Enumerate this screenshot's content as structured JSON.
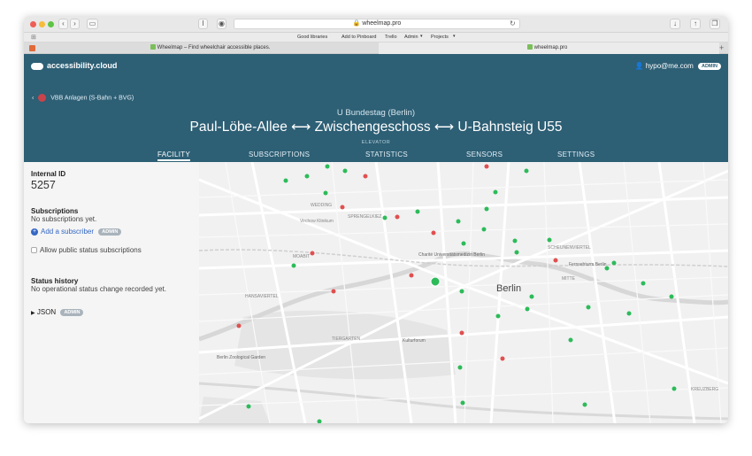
{
  "browser": {
    "url": "wheelmap.pro",
    "favorites": [
      "Good libraries",
      "Add to Pinboard",
      "Trello",
      "Admin",
      "Projects"
    ],
    "tabs": [
      {
        "label": "Wheelmap – Find wheelchair accessible places."
      },
      {
        "label": "wheelmap.pro"
      }
    ]
  },
  "app": {
    "brand": "accessibility.cloud",
    "user_email": "hypo@me.com",
    "user_badge": "ADMIN"
  },
  "breadcrumb": {
    "label": "VBB Anlagen (S-Bahn + BVG)"
  },
  "facility": {
    "station": "U Bundestag (Berlin)",
    "title": "Paul-Löbe-Allee ⟷ Zwischengeschoss ⟷ U-Bahnsteig U55",
    "kind": "ELEVATOR"
  },
  "nav_tabs": [
    "FACILITY",
    "SUBSCRIPTIONS",
    "STATISTICS",
    "SENSORS",
    "SETTINGS"
  ],
  "sidebar": {
    "internal_id_label": "Internal ID",
    "internal_id_value": "5257",
    "subscriptions_label": "Subscriptions",
    "subscriptions_empty": "No subscriptions yet.",
    "add_subscriber": "Add a subscriber",
    "add_subscriber_badge": "ADMIN",
    "allow_public": "Allow public status subscriptions",
    "status_history_label": "Status history",
    "status_history_empty": "No operational status change recorded yet.",
    "json_label": "JSON",
    "json_badge": "ADMIN"
  },
  "map": {
    "labels": {
      "berlin": "Berlin",
      "charite": "Charité Universitätsmedizin Berlin",
      "moabit": "MOABIT",
      "hansaviertel": "HANSAVIERTEL",
      "tiergarten": "TIERGARTEN",
      "kulturforum": "Kulturforum",
      "zoo": "Berlin Zoological Garden",
      "kreuzberg": "KREUZBERG",
      "scheunenviertel": "SCHEUNENVIERTEL",
      "fernsehturm": "Fernsehturm Berlin",
      "wedding": "WEDDING",
      "mitte": "MITTE",
      "sprengelkiez": "SPRENGELKIEZ",
      "virchow": "Virchow Klinikum"
    },
    "colors": {
      "ok": "#2dbb5a",
      "broken": "#e05050",
      "water": "#dadada",
      "park": "#e2e2e2"
    }
  }
}
